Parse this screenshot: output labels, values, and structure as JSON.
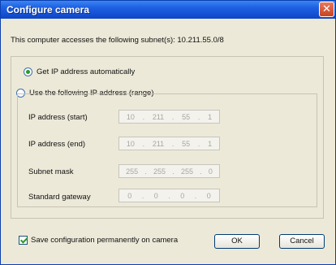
{
  "dialog": {
    "title": "Configure camera",
    "close_icon": "close-icon",
    "subnet_text": "This computer accesses the following subnet(s): 10.211.55.0/8"
  },
  "options": {
    "auto": {
      "label": "Get IP address automatically",
      "selected": true
    },
    "manual": {
      "label": "Use the following IP address (range)",
      "selected": false
    }
  },
  "fields": [
    {
      "label": "IP address (start)",
      "octets": [
        "10",
        "211",
        "55",
        "1"
      ]
    },
    {
      "label": "IP address (end)",
      "octets": [
        "10",
        "211",
        "55",
        "1"
      ]
    },
    {
      "label": "Subnet mask",
      "octets": [
        "255",
        "255",
        "255",
        "0"
      ]
    },
    {
      "label": "Standard gateway",
      "octets": [
        "0",
        "0",
        "0",
        "0"
      ]
    }
  ],
  "save_option": {
    "label": "Save configuration permanently on camera",
    "checked": true
  },
  "buttons": {
    "ok": "OK",
    "cancel": "Cancel"
  },
  "colors": {
    "titlebar": "#1552d6",
    "dialog_bg": "#ece9d8",
    "close": "#c8431f"
  }
}
